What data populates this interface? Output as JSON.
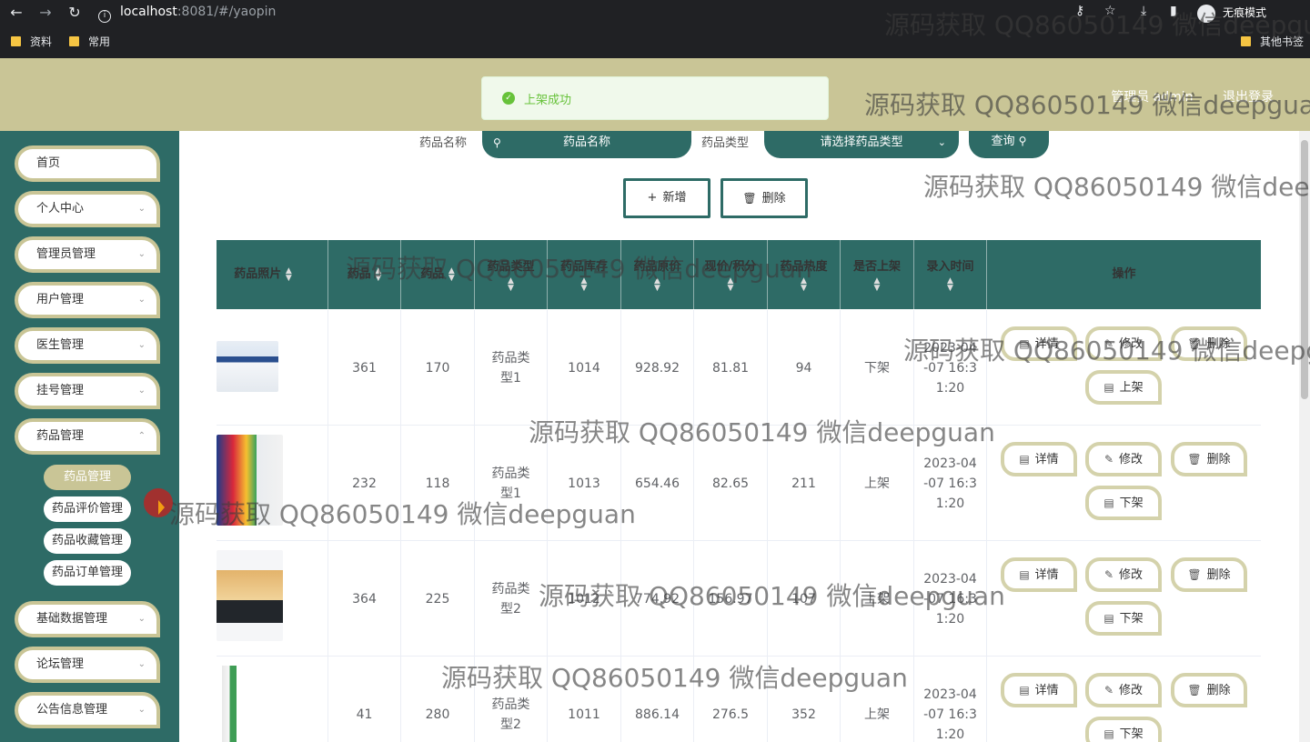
{
  "browser": {
    "url_host": "localhost",
    "url_path": ":8081/#/yaopin",
    "incognito_label": "无痕模式",
    "bookmarks": [
      "资料",
      "常用"
    ],
    "other_bookmarks": "其他书签"
  },
  "header": {
    "admin_text": "管理员 admin",
    "logout": "退出登录"
  },
  "toast": {
    "message": "上架成功"
  },
  "sidebar": {
    "items": [
      {
        "label": "首页"
      },
      {
        "label": "个人中心"
      },
      {
        "label": "管理员管理"
      },
      {
        "label": "用户管理"
      },
      {
        "label": "医生管理"
      },
      {
        "label": "挂号管理"
      },
      {
        "label": "药品管理"
      },
      {
        "label": "基础数据管理"
      },
      {
        "label": "论坛管理"
      },
      {
        "label": "公告信息管理"
      }
    ],
    "submenu": [
      "药品管理",
      "药品评价管理",
      "药品收藏管理",
      "药品订单管理"
    ]
  },
  "search": {
    "name_label": "药品名称",
    "name_placeholder": "药品名称",
    "type_label": "药品类型",
    "type_placeholder": "请选择药品类型",
    "query_button": "查询"
  },
  "actions": {
    "add": "新增",
    "delete": "删除"
  },
  "table": {
    "headers": [
      "药品照片",
      "药品",
      "药品",
      "药品类型",
      "药品库存",
      "药品原价",
      "现价/积分",
      "药品热度",
      "是否上架",
      "录入时间",
      "操作"
    ],
    "rows": [
      {
        "col2": "361",
        "col3": "170",
        "type": "药品类型1",
        "stock": "1014",
        "price": "928.92",
        "now": "81.81",
        "heat": "94",
        "status": "下架",
        "time": "2023-04-07 16:31:20",
        "toggle": "上架"
      },
      {
        "col2": "232",
        "col3": "118",
        "type": "药品类型1",
        "stock": "1013",
        "price": "654.46",
        "now": "82.65",
        "heat": "211",
        "status": "上架",
        "time": "2023-04-07 16:31:20",
        "toggle": "下架"
      },
      {
        "col2": "364",
        "col3": "225",
        "type": "药品类型2",
        "stock": "1012",
        "price": "774.92",
        "now": "156.97",
        "heat": "107",
        "status": "上架",
        "time": "2023-04-07 16:31:20",
        "toggle": "下架"
      },
      {
        "col2": "41",
        "col3": "280",
        "type": "药品类型2",
        "stock": "1011",
        "price": "886.14",
        "now": "276.5",
        "heat": "352",
        "status": "上架",
        "time": "2023-04-07 16:31:20",
        "toggle": "下架"
      }
    ],
    "op_labels": {
      "detail": "详情",
      "edit": "修改",
      "delete": "删除"
    }
  },
  "watermark": "源码获取 QQ86050149 微信deepguan",
  "colors": {
    "teal": "#2e6b66",
    "olive": "#c9c596",
    "success": "#67c23a"
  }
}
